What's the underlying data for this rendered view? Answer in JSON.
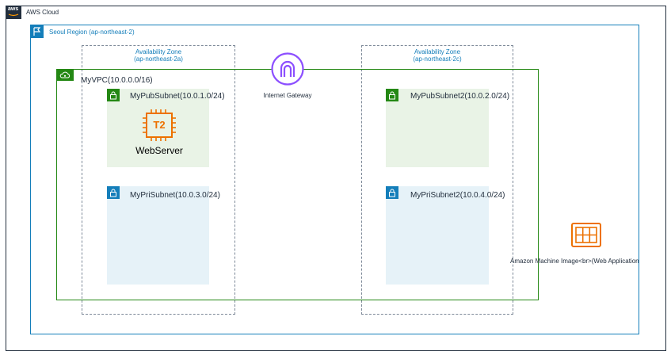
{
  "cloud": {
    "logo": "aws",
    "label": "AWS Cloud"
  },
  "region": {
    "label": "Seoul Region (ap-northeast-2)",
    "icon": "flag-icon"
  },
  "az_a": {
    "line1": "Availability Zone",
    "line2": "(ap-northeast-2a)"
  },
  "az_c": {
    "line1": "Availability Zone",
    "line2": "(ap-northeast-2c)"
  },
  "vpc": {
    "label": "MyVPC(10.0.0.0/16)",
    "icon": "vpc-cloud-icon"
  },
  "igw": {
    "label": "Internet Gateway",
    "icon": "internet-gateway-icon"
  },
  "subnets": {
    "pub1": "MyPubSubnet(10.0.1.0/24)",
    "pub2": "MyPubSubnet2(10.0.2.0/24)",
    "pri1": "MyPriSubnet(10.0.3.0/24)",
    "pri2": "MyPriSubnet2(10.0.4.0/24)"
  },
  "instance": {
    "type": "T2",
    "label": "WebServer",
    "icon": "ec2-instance-icon"
  },
  "ami": {
    "label": "Amazon Machine Image<br>(Web Application",
    "icon": "ami-icon"
  },
  "colors": {
    "green": "#248814",
    "blue": "#147eba",
    "orange": "#ed7100",
    "purple": "#8c4fff",
    "ink": "#232f3e"
  }
}
